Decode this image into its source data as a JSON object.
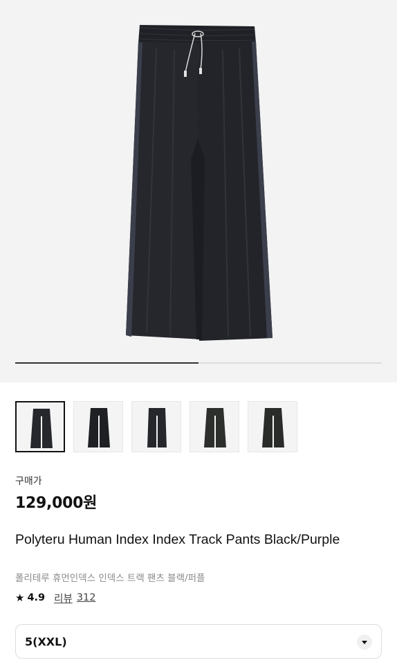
{
  "product": {
    "image_alt": "Black track pants",
    "gallery_progress_fraction": 0.5,
    "thumbnails": [
      {
        "active": true
      },
      {
        "active": false
      },
      {
        "active": false
      },
      {
        "active": false
      },
      {
        "active": false
      }
    ],
    "price_label": "구매가",
    "price": "129,000원",
    "name_en": "Polyteru Human Index Index Track Pants Black/Purple",
    "name_ko": "폴리테루 휴먼인덱스 인덱스 트랙 팬츠 블랙/퍼플",
    "rating": "4.9",
    "review_label": "리뷰",
    "review_count": "312"
  },
  "size_select": {
    "value": "5(XXL)"
  },
  "colors": {
    "hero_bg": "#f3f3f3",
    "pants": "#24262b",
    "side_stripe": "#3a3e4a"
  }
}
